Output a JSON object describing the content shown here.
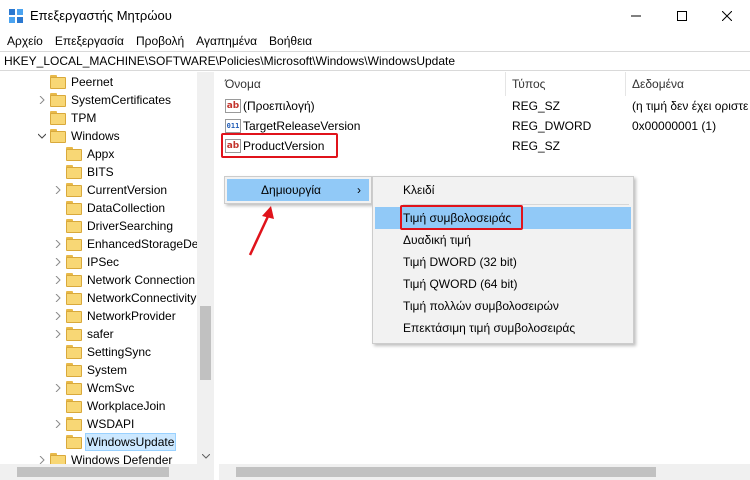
{
  "window": {
    "title": "Επεξεργαστής Μητρώου",
    "minimize_icon": "minimize-icon",
    "maximize_icon": "maximize-icon",
    "close_icon": "close-icon"
  },
  "menu": [
    "Αρχείο",
    "Επεξεργασία",
    "Προβολή",
    "Αγαπημένα",
    "Βοήθεια"
  ],
  "address": "HKEY_LOCAL_MACHINE\\SOFTWARE\\Policies\\Microsoft\\Windows\\WindowsUpdate",
  "tree": {
    "items": [
      {
        "label": "Peernet",
        "level": 1,
        "expander": "none"
      },
      {
        "label": "SystemCertificates",
        "level": 1,
        "expander": "collapsed"
      },
      {
        "label": "TPM",
        "level": 1,
        "expander": "none"
      },
      {
        "label": "Windows",
        "level": 1,
        "expander": "expanded"
      },
      {
        "label": "Appx",
        "level": 2,
        "expander": "none"
      },
      {
        "label": "BITS",
        "level": 2,
        "expander": "none"
      },
      {
        "label": "CurrentVersion",
        "level": 2,
        "expander": "collapsed"
      },
      {
        "label": "DataCollection",
        "level": 2,
        "expander": "none"
      },
      {
        "label": "DriverSearching",
        "level": 2,
        "expander": "none"
      },
      {
        "label": "EnhancedStorageDe",
        "level": 2,
        "expander": "collapsed"
      },
      {
        "label": "IPSec",
        "level": 2,
        "expander": "collapsed"
      },
      {
        "label": "Network Connection",
        "level": 2,
        "expander": "collapsed"
      },
      {
        "label": "NetworkConnectivity",
        "level": 2,
        "expander": "collapsed"
      },
      {
        "label": "NetworkProvider",
        "level": 2,
        "expander": "collapsed"
      },
      {
        "label": "safer",
        "level": 2,
        "expander": "collapsed"
      },
      {
        "label": "SettingSync",
        "level": 2,
        "expander": "none"
      },
      {
        "label": "System",
        "level": 2,
        "expander": "none"
      },
      {
        "label": "WcmSvc",
        "level": 2,
        "expander": "collapsed"
      },
      {
        "label": "WorkplaceJoin",
        "level": 2,
        "expander": "none"
      },
      {
        "label": "WSDAPI",
        "level": 2,
        "expander": "collapsed"
      },
      {
        "label": "WindowsUpdate",
        "level": 2,
        "expander": "none",
        "selected": true
      },
      {
        "label": "Windows Defender",
        "level": 1,
        "expander": "collapsed"
      }
    ]
  },
  "list": {
    "columns": [
      "Όνομα",
      "Τύπος",
      "Δεδομένα"
    ],
    "rows": [
      {
        "icon": "ab",
        "name": "(Προεπιλογή)",
        "type": "REG_SZ",
        "data": "(η τιμή δεν έχει οριστε"
      },
      {
        "icon": "011",
        "name": "TargetReleaseVersion",
        "type": "REG_DWORD",
        "data": "0x00000001 (1)"
      },
      {
        "icon": "ab",
        "name": "ProductVersion",
        "type": "REG_SZ",
        "data": ""
      }
    ]
  },
  "context_menu": {
    "new_label": "Δημιουργία",
    "submenu_arrow": "›",
    "submenu": [
      "Κλειδί",
      "Τιμή συμβολοσειράς",
      "Δυαδική τιμή",
      "Τιμή DWORD (32 bit)",
      "Τιμή QWORD (64 bit)",
      "Τιμή πολλών συμβολοσειρών",
      "Επεκτάσιμη τιμή συμβολοσειράς"
    ]
  },
  "colors": {
    "annotation_red": "#e0131b",
    "highlight": "#91c9f7",
    "folder": "#f8d775"
  }
}
